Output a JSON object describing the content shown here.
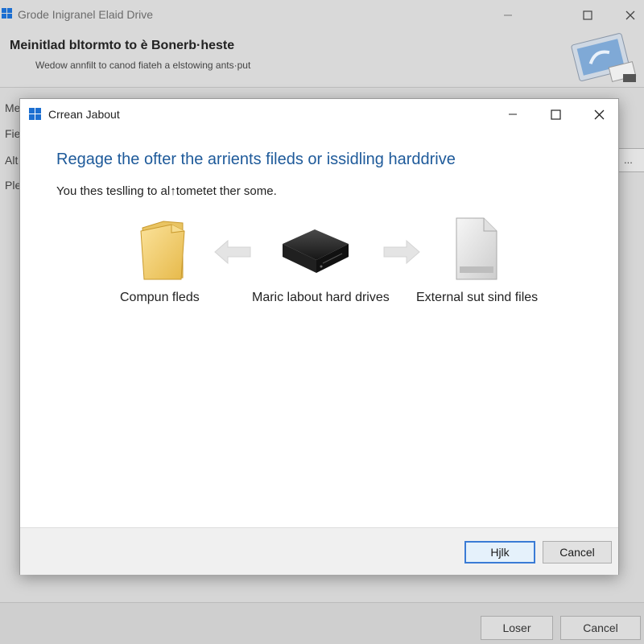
{
  "background_window": {
    "title": "Grode Inigranel Elaid Drive",
    "controls": {
      "minimize_icon": "minimize-icon",
      "maximize_icon": "maximize-icon",
      "close_icon": "close-icon"
    },
    "header": {
      "heading": "Meinitlad bltormto to è Bonerb·heste",
      "subheading": "Wedow annfilt to canod fiateh a elstowing ants·put"
    },
    "side_labels": [
      "Me",
      "Fie",
      "Alt",
      "Ple"
    ],
    "browse_label": "...",
    "buttons": {
      "left": "Loser",
      "cancel": "Cancel"
    }
  },
  "dialog": {
    "title": "Crrean Jabout",
    "heading": "Regage the ofter the arrients fileds or issidling harddrive",
    "instruction": "You thes teslling to al↑tometet ther some.",
    "items": [
      {
        "label": "Compun fleds",
        "icon": "folder-icon"
      },
      {
        "label": "Maric labout hard drives",
        "icon": "hard-drive-icon"
      },
      {
        "label": "External sut sind files",
        "icon": "file-icon"
      }
    ],
    "arrows": [
      "arrow-left-icon",
      "arrow-right-icon"
    ],
    "buttons": {
      "primary": "Hjlk",
      "cancel": "Cancel"
    }
  },
  "colors": {
    "heading_blue": "#1e5a9a",
    "primary_border": "#3a7bd5",
    "windows_logo": "#1c6fd1"
  }
}
